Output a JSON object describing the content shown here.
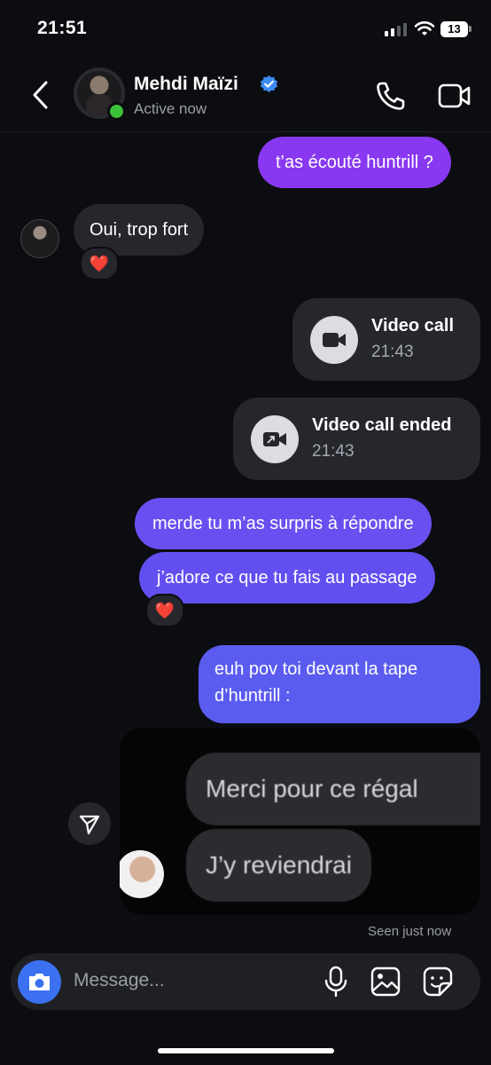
{
  "status_bar": {
    "time": "21:51",
    "battery": "13"
  },
  "header": {
    "contact_name": "Mehdi Maïzi",
    "status": "Active now",
    "icons": [
      "back-chevron-icon",
      "verified-badge-icon",
      "phone-icon",
      "video-camera-icon"
    ]
  },
  "messages": [
    {
      "type": "sent",
      "text": "t’as écouté huntrill ?"
    },
    {
      "type": "received",
      "text": "Oui, trop fort",
      "reaction": "❤️"
    },
    {
      "type": "call",
      "title": "Video call",
      "time": "21:43"
    },
    {
      "type": "call",
      "title": "Video call ended",
      "time": "21:43"
    },
    {
      "type": "sent",
      "text": "merde tu m’as surpris à répondre"
    },
    {
      "type": "sent",
      "text": "j’adore ce que tu fais au passage",
      "reaction": "❤️"
    },
    {
      "type": "sent",
      "text": "euh pov toi devant la tape d’huntrill :"
    },
    {
      "type": "media",
      "lines": [
        "Merci pour ce régal",
        "J’y reviendrai"
      ]
    }
  ],
  "seen_label": "Seen just now",
  "composer": {
    "placeholder": "Message...",
    "icons": [
      "camera-icon",
      "microphone-icon",
      "gallery-icon",
      "sticker-icon"
    ]
  },
  "colors": {
    "sent_purple": "#8838f0",
    "sent_blue": "#5a5cf0",
    "received": "#26272c",
    "camera_button": "#3b71f0"
  }
}
